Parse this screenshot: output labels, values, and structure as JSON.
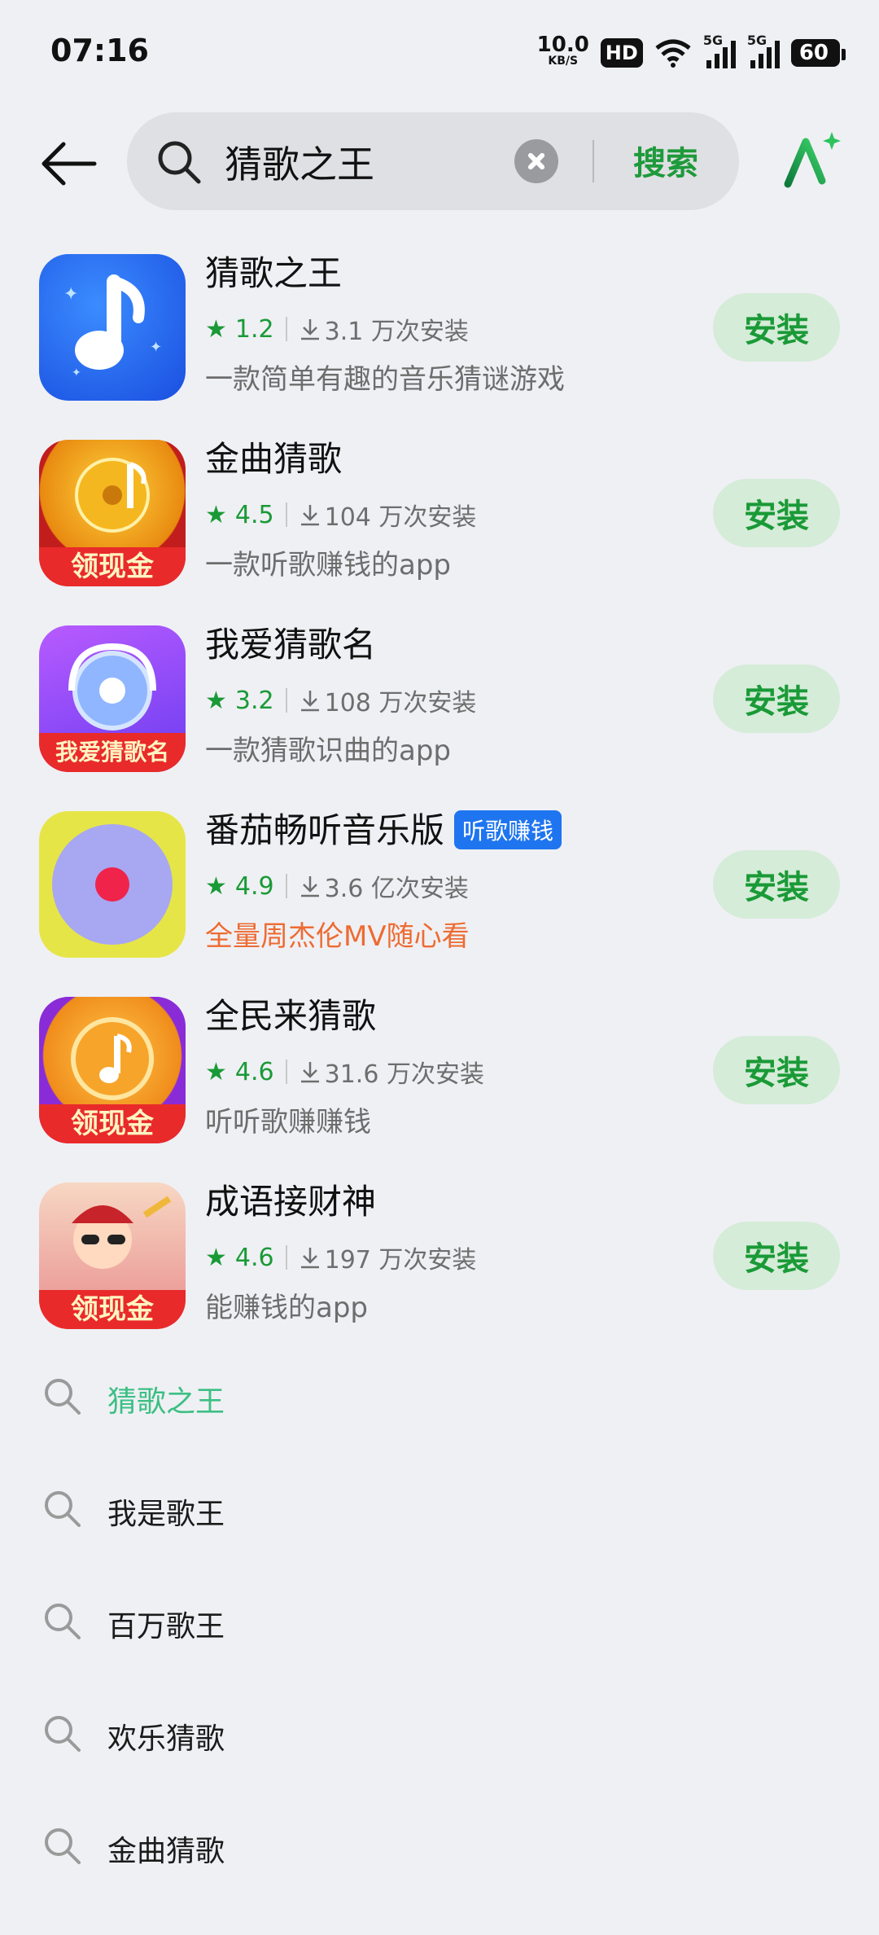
{
  "status": {
    "time": "07:16",
    "net_speed": "10.0",
    "net_unit": "KB/S",
    "hd": "HD",
    "signal_label": "5G",
    "battery": "60"
  },
  "search": {
    "query": "猜歌之王",
    "button": "搜索"
  },
  "apps": [
    {
      "name": "猜歌之王",
      "tag": "",
      "rating": "1.2",
      "installs": "3.1 万次安装",
      "desc": "一款简单有趣的音乐猜谜游戏",
      "promo": false,
      "icon": "music-note-icon",
      "ribbon": "",
      "action": "安装"
    },
    {
      "name": "金曲猜歌",
      "tag": "",
      "rating": "4.5",
      "installs": "104 万次安装",
      "desc": "一款听歌赚钱的app",
      "promo": false,
      "icon": "gold-disc-icon",
      "ribbon": "领现金",
      "action": "安装"
    },
    {
      "name": "我爱猜歌名",
      "tag": "",
      "rating": "3.2",
      "installs": "108 万次安装",
      "desc": "一款猜歌识曲的app",
      "promo": false,
      "icon": "headphone-cat-icon",
      "ribbon": "我爱猜歌名",
      "action": "安装"
    },
    {
      "name": "番茄畅听音乐版",
      "tag": "听歌赚钱",
      "rating": "4.9",
      "installs": "3.6 亿次安装",
      "desc": "全量周杰伦MV随心看",
      "promo": true,
      "icon": "record-icon",
      "ribbon": "",
      "action": "安装"
    },
    {
      "name": "全民来猜歌",
      "tag": "",
      "rating": "4.6",
      "installs": "31.6 万次安装",
      "desc": "听听歌赚赚钱",
      "promo": false,
      "icon": "headphone-note-icon",
      "ribbon": "领现金",
      "action": "安装"
    },
    {
      "name": "成语接财神",
      "tag": "",
      "rating": "4.6",
      "installs": "197 万次安装",
      "desc": "能赚钱的app",
      "promo": false,
      "icon": "fortune-god-icon",
      "ribbon": "领现金",
      "action": "安装"
    }
  ],
  "suggestions": [
    "猜歌之王",
    "我是歌王",
    "百万歌王",
    "欢乐猜歌",
    "金曲猜歌"
  ],
  "colors": {
    "accent": "#1a9a37",
    "install_bg": "#d5ecd8",
    "promo": "#ee6b32",
    "tag": "#1f75f0",
    "suggest_active": "#3cbf84"
  }
}
